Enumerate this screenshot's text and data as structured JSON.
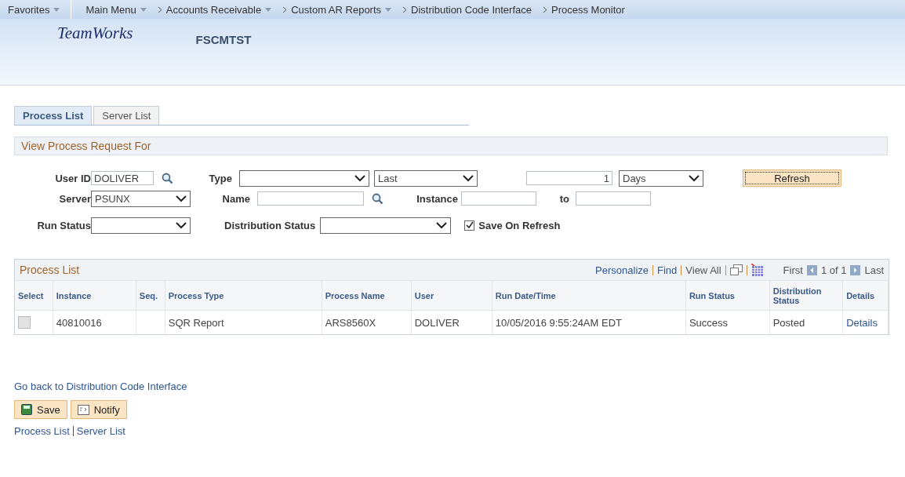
{
  "nav": [
    {
      "label": "Favorites",
      "chevron": false,
      "menu": true
    },
    {
      "label": "Main Menu",
      "chevron": false,
      "menu": true
    },
    {
      "label": "Accounts Receivable",
      "chevron": true,
      "menu": true
    },
    {
      "label": "Custom AR Reports",
      "chevron": true,
      "menu": true
    },
    {
      "label": "Distribution Code Interface",
      "chevron": true,
      "menu": false
    },
    {
      "label": "Process Monitor",
      "chevron": true,
      "menu": false
    }
  ],
  "header": {
    "logo": "TeamWorks",
    "database": "FSCMTST"
  },
  "tabs": [
    {
      "label": "Process List",
      "selected": true
    },
    {
      "label": "Server List",
      "selected": false
    }
  ],
  "filter": {
    "title": "View Process Request For",
    "user_id": {
      "label": "User ID",
      "value": "DOLIVER"
    },
    "type": {
      "label": "Type"
    },
    "period": {
      "value": "Last"
    },
    "count": {
      "value": "1"
    },
    "unit": {
      "value": "Days"
    },
    "refresh": "Refresh",
    "server": {
      "label": "Server",
      "value": "PSUNX"
    },
    "name": {
      "label": "Name"
    },
    "instance": {
      "label": "Instance"
    },
    "to": {
      "label": "to"
    },
    "run_status": {
      "label": "Run Status"
    },
    "distribution_status": {
      "label": "Distribution Status"
    },
    "save_on_refresh": {
      "label": "Save On Refresh",
      "checked": true
    }
  },
  "grid": {
    "title": "Process List",
    "links": [
      "Personalize",
      "Find",
      "View All"
    ],
    "first": "First",
    "range": "1 of 1",
    "last": "Last",
    "columns": [
      "Select",
      "Instance",
      "Seq.",
      "Process Type",
      "Process Name",
      "User",
      "Run Date/Time",
      "Run Status",
      "Distribution Status",
      "Details"
    ],
    "rows": [
      {
        "selected": false,
        "instance": "40810016",
        "seq": "",
        "process_type": "SQR Report",
        "process_name": "ARS8560X",
        "user": "DOLIVER",
        "run_date_time": "10/05/2016  9:55:24AM EDT",
        "run_status": "Success",
        "distribution_status": "Posted",
        "details": "Details"
      }
    ]
  },
  "back_link": "Go back to Distribution Code Interface",
  "buttons": [
    {
      "kind": "save",
      "label": "Save"
    },
    {
      "kind": "notify",
      "label": "Notify"
    }
  ],
  "footer_links": [
    "Process List",
    "Server List"
  ]
}
